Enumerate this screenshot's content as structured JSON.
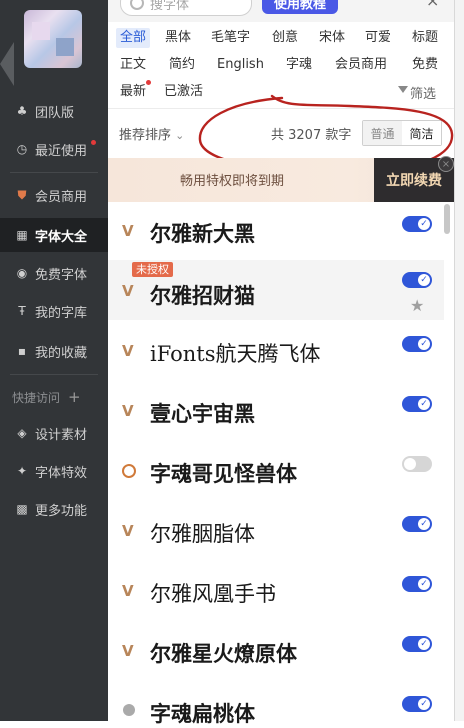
{
  "search": {
    "placeholder": "搜字体"
  },
  "header": {
    "tutorial_label": "使用教程",
    "close_glyph": "×"
  },
  "sidebar": {
    "items": [
      {
        "label": "团队版",
        "icon": "team-icon"
      },
      {
        "label": "最近使用",
        "icon": "clock-icon"
      },
      {
        "label": "会员商用",
        "icon": "shield-icon"
      },
      {
        "label": "字体大全",
        "icon": "grid-icon"
      },
      {
        "label": "免费字体",
        "icon": "free-icon"
      },
      {
        "label": "我的字库",
        "icon": "font-library-icon"
      },
      {
        "label": "我的收藏",
        "icon": "folder-icon"
      },
      {
        "label": "设计素材",
        "icon": "layers-icon"
      },
      {
        "label": "字体特效",
        "icon": "magic-icon"
      },
      {
        "label": "更多功能",
        "icon": "apps-icon"
      }
    ],
    "quick_access": {
      "label": "快捷访问",
      "plus": "+"
    }
  },
  "categories": {
    "row1": [
      "全部",
      "黑体",
      "毛笔字",
      "创意",
      "宋体",
      "可爱",
      "标题"
    ],
    "row2": [
      "正文",
      "简约",
      "English",
      "字魂",
      "会员商用",
      "免费"
    ],
    "row3": [
      "最新",
      "已激活"
    ],
    "filter_label": "筛选"
  },
  "sort": {
    "label": "推荐排序",
    "chevron": "⌄"
  },
  "count": {
    "text": "共 3207 款字"
  },
  "view_toggle": {
    "normal": "普通",
    "compact": "简洁"
  },
  "banner": {
    "text": "畅用特权即将到期",
    "renew_label": "立即续费",
    "close_glyph": "×"
  },
  "fonts": [
    {
      "name": "尔雅新大黑",
      "enabled": true
    },
    {
      "name": "尔雅招财猫",
      "enabled": true,
      "badge": "未授权"
    },
    {
      "name": "iFonts航天腾飞体",
      "enabled": true
    },
    {
      "name": "壹心宇宙黑",
      "enabled": true
    },
    {
      "name": "字魂哥见怪兽体",
      "enabled": false
    },
    {
      "name": "尔雅胭脂体",
      "enabled": true
    },
    {
      "name": "尔雅风凰手书",
      "enabled": true
    },
    {
      "name": "尔雅星火燎原体",
      "enabled": true
    },
    {
      "name": "字魂扁桃体",
      "enabled": true
    }
  ],
  "colors": {
    "accent": "#2f56d8",
    "sidebar_bg": "#323538",
    "vip": "#b8865a"
  }
}
